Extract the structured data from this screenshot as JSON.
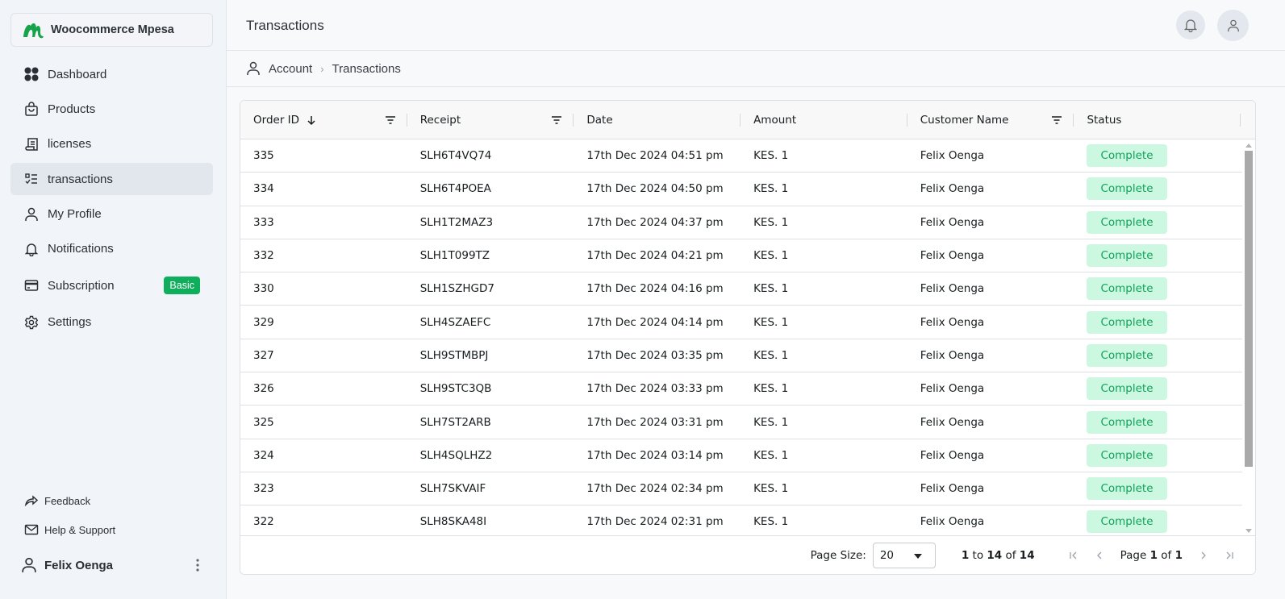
{
  "app": {
    "name": "Woocommerce Mpesa",
    "brand_color": "#16a34a"
  },
  "sidebar": {
    "items": [
      {
        "label": "Dashboard",
        "icon": "dashboard-icon",
        "active": false
      },
      {
        "label": "Products",
        "icon": "shopping-bag-icon",
        "active": false
      },
      {
        "label": "licenses",
        "icon": "receipt-icon",
        "active": false
      },
      {
        "label": "transactions",
        "icon": "list-check-icon",
        "active": true
      },
      {
        "label": "My Profile",
        "icon": "user-icon",
        "active": false
      },
      {
        "label": "Notifications",
        "icon": "bell-icon",
        "active": false
      },
      {
        "label": "Subscription",
        "icon": "credit-card-icon",
        "active": false,
        "badge": "Basic"
      },
      {
        "label": "Settings",
        "icon": "gear-icon",
        "active": false
      }
    ],
    "footer": [
      {
        "label": "Feedback",
        "icon": "share-icon"
      },
      {
        "label": "Help & Support",
        "icon": "mail-icon"
      }
    ],
    "user": {
      "name": "Felix Oenga"
    }
  },
  "header": {
    "title": "Transactions"
  },
  "breadcrumb": {
    "items": [
      "Account",
      "Transactions"
    ]
  },
  "table": {
    "columns": [
      {
        "label": "Order ID",
        "sorted": "desc",
        "filter": true
      },
      {
        "label": "Receipt",
        "filter": true
      },
      {
        "label": "Date",
        "filter": false
      },
      {
        "label": "Amount",
        "filter": false
      },
      {
        "label": "Customer Name",
        "filter": true
      },
      {
        "label": "Status",
        "filter": false
      }
    ],
    "rows": [
      [
        "335",
        "SLH6T4VQ74",
        "17th Dec 2024 04:51 pm",
        "KES. 1",
        "Felix Oenga",
        "Complete"
      ],
      [
        "334",
        "SLH6T4POEA",
        "17th Dec 2024 04:50 pm",
        "KES. 1",
        "Felix Oenga",
        "Complete"
      ],
      [
        "333",
        "SLH1T2MAZ3",
        "17th Dec 2024 04:37 pm",
        "KES. 1",
        "Felix Oenga",
        "Complete"
      ],
      [
        "332",
        "SLH1T099TZ",
        "17th Dec 2024 04:21 pm",
        "KES. 1",
        "Felix Oenga",
        "Complete"
      ],
      [
        "330",
        "SLH1SZHGD7",
        "17th Dec 2024 04:16 pm",
        "KES. 1",
        "Felix Oenga",
        "Complete"
      ],
      [
        "329",
        "SLH4SZAEFC",
        "17th Dec 2024 04:14 pm",
        "KES. 1",
        "Felix Oenga",
        "Complete"
      ],
      [
        "327",
        "SLH9STMBPJ",
        "17th Dec 2024 03:35 pm",
        "KES. 1",
        "Felix Oenga",
        "Complete"
      ],
      [
        "326",
        "SLH9STC3QB",
        "17th Dec 2024 03:33 pm",
        "KES. 1",
        "Felix Oenga",
        "Complete"
      ],
      [
        "325",
        "SLH7ST2ARB",
        "17th Dec 2024 03:31 pm",
        "KES. 1",
        "Felix Oenga",
        "Complete"
      ],
      [
        "324",
        "SLH4SQLHZ2",
        "17th Dec 2024 03:14 pm",
        "KES. 1",
        "Felix Oenga",
        "Complete"
      ],
      [
        "323",
        "SLH7SKVAIF",
        "17th Dec 2024 02:34 pm",
        "KES. 1",
        "Felix Oenga",
        "Complete"
      ],
      [
        "322",
        "SLH8SKA48I",
        "17th Dec 2024 02:31 pm",
        "KES. 1",
        "Felix Oenga",
        "Complete"
      ]
    ],
    "status_colors": {
      "Complete": {
        "bg": "#ccf7e1",
        "fg": "#10a35a"
      }
    }
  },
  "pagination": {
    "page_size_label": "Page Size:",
    "page_size": "20",
    "range_from": "1",
    "range_to": "14",
    "total": "14",
    "to_word": "to",
    "of_word": "of",
    "page_word": "Page",
    "current_page": "1",
    "total_pages": "1"
  }
}
